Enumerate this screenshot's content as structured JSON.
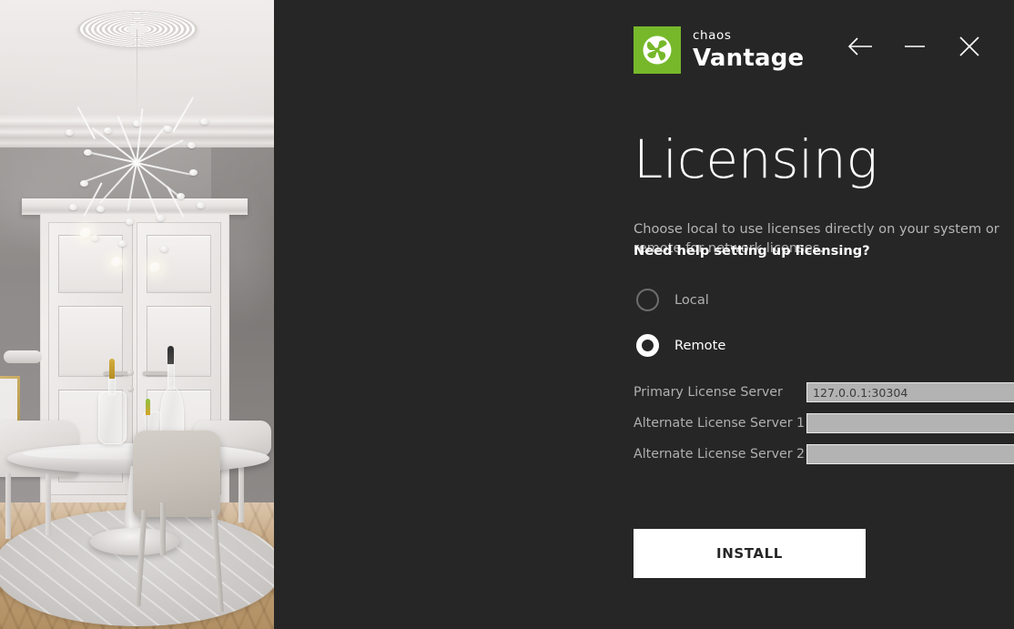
{
  "window": {
    "back_icon": "back-arrow-icon",
    "minimize_icon": "minimize-icon",
    "close_icon": "close-icon"
  },
  "brand": {
    "company": "chaos",
    "product": "Vantage",
    "mark_icon": "chaos-pinwheel-logo-icon",
    "mark_color": "#76b82a"
  },
  "page": {
    "title": "Licensing",
    "description": "Choose local to use licenses directly on your system or remote for network licenses.",
    "help_link": "Need help setting up licensing?"
  },
  "license_mode": {
    "selected": "remote",
    "options": [
      {
        "id": "local",
        "label": "Local",
        "checked": false
      },
      {
        "id": "remote",
        "label": "Remote",
        "checked": true
      }
    ]
  },
  "servers": {
    "fields": [
      {
        "label": "Primary License Server",
        "value": "127.0.0.1:30304",
        "placeholder": ""
      },
      {
        "label": "Alternate License Server 1",
        "value": "",
        "placeholder": ""
      },
      {
        "label": "Alternate License Server 2",
        "value": "",
        "placeholder": ""
      }
    ]
  },
  "actions": {
    "install_label": "INSTALL"
  },
  "theme": {
    "panel_bg": "#262626",
    "accent_green": "#76b82a",
    "input_bg": "#b3b3b3",
    "button_bg": "#ffffff"
  },
  "hero": {
    "alt": "interior-dining-room-render"
  }
}
